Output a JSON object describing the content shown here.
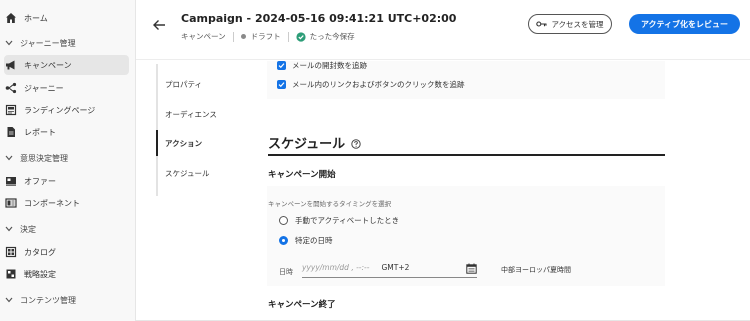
{
  "sidebar": {
    "items": [
      {
        "label": "ホーム",
        "type": "item",
        "icon": "home-icon"
      },
      {
        "label": "ジャーニー管理",
        "type": "section"
      },
      {
        "label": "キャンペーン",
        "type": "item",
        "icon": "megaphone-icon",
        "active": true
      },
      {
        "label": "ジャーニー",
        "type": "item",
        "icon": "journey-icon"
      },
      {
        "label": "ランディングページ",
        "type": "item",
        "icon": "landing-page-icon"
      },
      {
        "label": "レポート",
        "type": "item",
        "icon": "report-icon"
      },
      {
        "label": "意思決定管理",
        "type": "section"
      },
      {
        "label": "オファー",
        "type": "item",
        "icon": "offer-icon"
      },
      {
        "label": "コンポーネント",
        "type": "item",
        "icon": "component-icon"
      },
      {
        "label": "決定",
        "type": "section"
      },
      {
        "label": "カタログ",
        "type": "item",
        "icon": "catalog-icon"
      },
      {
        "label": "戦略設定",
        "type": "item",
        "icon": "strategy-icon"
      },
      {
        "label": "コンテンツ管理",
        "type": "section"
      }
    ]
  },
  "header": {
    "title": "Campaign - 2024-05-16 09:41:21 UTC+02:00",
    "type_label": "キャンペーン",
    "status_label": "ドラフト",
    "saved_label": "たった今保存",
    "access_button": "アクセスを管理",
    "activate_button": "アクティブ化をレビュー"
  },
  "page_nav": {
    "items": [
      "プロパティ",
      "オーディエンス",
      "アクション",
      "スケジュール"
    ],
    "active_index": 2
  },
  "content": {
    "checkboxes": [
      {
        "label": "メールの開封数を追跡",
        "checked": true
      },
      {
        "label": "メール内のリンクおよびボタンのクリック数を追跡",
        "checked": true
      }
    ],
    "schedule_title": "スケジュール",
    "start_title": "キャンペーン開始",
    "timing_label": "キャンペーンを開始するタイミングを選択",
    "radio_options": [
      {
        "label": "手動でアクティベートしたとき",
        "selected": false
      },
      {
        "label": "特定の日時",
        "selected": true
      }
    ],
    "date_label": "日時",
    "date_placeholder": "yyyy/mm/dd , --:--",
    "timezone_offset": "GMT+2",
    "timezone_name": "中部ヨーロッパ夏時間",
    "end_title": "キャンペーン終了"
  },
  "colors": {
    "accent": "#1473e6",
    "saved_green": "#2d9d78"
  }
}
